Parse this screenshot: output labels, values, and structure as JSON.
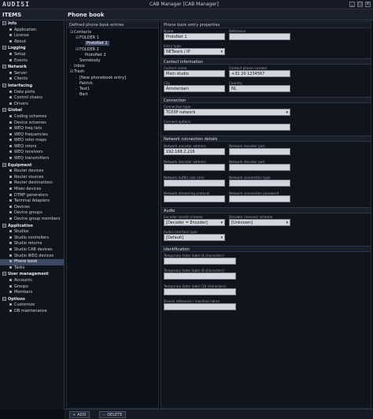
{
  "app": {
    "logo": "AUDISI",
    "window_title": "CAB Manager [CAB Manager]",
    "win_buttons": [
      "_",
      "□",
      "×"
    ]
  },
  "sidebar": {
    "title": "ITEMS",
    "groups": [
      {
        "label": "Info",
        "items": [
          "Application",
          "License",
          "About"
        ]
      },
      {
        "label": "Logging",
        "items": [
          "Setup",
          "Events"
        ]
      },
      {
        "label": "Network",
        "items": [
          "Server",
          "Clients"
        ]
      },
      {
        "label": "Interfacing",
        "items": [
          "Data ports",
          "Control chains",
          "Drivers"
        ]
      },
      {
        "label": "Global",
        "items": [
          "Coding schemes",
          "Device schemes",
          "WEQ freq lists",
          "WEQ frequencies",
          "WEQ rotor maps",
          "WEQ rotors",
          "WEQ receivers",
          "WEQ transmitters"
        ]
      },
      {
        "label": "Equipment",
        "items": [
          "Router devices",
          "Router sources",
          "Router destinations",
          "Mixer devices",
          "DTMF generators",
          "Terminal Adapters",
          "Devices",
          "Device groups",
          "Device group members"
        ]
      },
      {
        "label": "Application",
        "items": [
          "Studios",
          "Studio controllers",
          "Studio returns",
          "Studio CAB devices",
          "Studio WEQ devices",
          "Phone book",
          "Tasks"
        ]
      },
      {
        "label": "User management",
        "items": [
          "Accounts",
          "Groups",
          "Members"
        ]
      },
      {
        "label": "Options",
        "items": [
          "Customize",
          "DB maintenance"
        ]
      }
    ],
    "selected": "Phone book"
  },
  "main": {
    "title": "Phone book"
  },
  "tree": {
    "title": "Defined phone book entries",
    "rows": [
      {
        "label": "Contacts",
        "level": 0,
        "sym": "⊟"
      },
      {
        "label": "FOLDER 1",
        "level": 1,
        "sym": "⊟"
      },
      {
        "label": "ProtoNet 1",
        "level": 2,
        "sym": "·",
        "selected": true
      },
      {
        "label": "FOLDER 2",
        "level": 1,
        "sym": "⊟"
      },
      {
        "label": "ProtoNet 2",
        "level": 2,
        "sym": "·"
      },
      {
        "label": "Somebody",
        "level": 1,
        "sym": "·"
      },
      {
        "label": "Inbox",
        "level": 0,
        "sym": "·"
      },
      {
        "label": "Trash",
        "level": 0,
        "sym": "⊟"
      },
      {
        "label": "[New phonebook entry]",
        "level": 1,
        "sym": "·"
      },
      {
        "label": "Patrick",
        "level": 1,
        "sym": "·"
      },
      {
        "label": "Test1",
        "level": 1,
        "sym": "·"
      },
      {
        "label": "Bart",
        "level": 1,
        "sym": "·"
      }
    ]
  },
  "props": {
    "title": "Phone book entry properties",
    "name_label": "Name",
    "name": "ProtoNet 1",
    "reference_label": "Reference",
    "reference": "",
    "entry_type_label": "Entry type",
    "entry_type": "NETwork / IP",
    "contact_section": "Contact information",
    "contact_name_label": "Contact name",
    "contact_name": "Main studio",
    "contact_phone_label": "Contact phone number",
    "contact_phone": "+31 20 1234567",
    "city_label": "City",
    "city": "Amsterdam",
    "country_label": "Country",
    "country": "NL",
    "connection_section": "Connection",
    "connection_type_label": "Connection type",
    "connection_type": "TCP/IP network",
    "connect_options_label": "Connect options",
    "connect_options": "",
    "netconn_section": "Network connection details",
    "encoder_address_label": "Network encoder address",
    "encoder_address": "192.168.2.216",
    "encoder_port_label": "Network encoder port",
    "encoder_port": "",
    "decoder_address_label": "Network decoder address",
    "decoder_address": "",
    "decoder_port_label": "Network decoder port",
    "decoder_port": "",
    "buffer_label": "Network buffer size (ms)",
    "buffer": "",
    "net_conn_type_label": "Network connection type",
    "net_conn_type": "",
    "streaming_label": "Network streaming protocol",
    "streaming": "",
    "net_password_label": "Network connection password",
    "net_password": "",
    "audio_section": "Audio",
    "encoder_scheme_label": "Encoder (send) scheme",
    "encoder_scheme": "[Decoder = Encoder]",
    "decoder_scheme_label": "Decoder (receive) scheme",
    "decoder_scheme": "[Unknown]",
    "audio_if_label": "Audio interface type",
    "audio_if": "[Default]",
    "ident_section": "Identification",
    "fader4_label": "Temporary fader label (4 characters)",
    "fader4": "",
    "fader8_label": "Temporary fader label (8 characters)",
    "fader8": "",
    "fader16_label": "Temporary fader label (16 characters)",
    "fader16": "",
    "device_ref_label": "Device reference / machine name",
    "device_ref": ""
  },
  "actions": {
    "add": "ADD",
    "delete": "DELETE"
  }
}
